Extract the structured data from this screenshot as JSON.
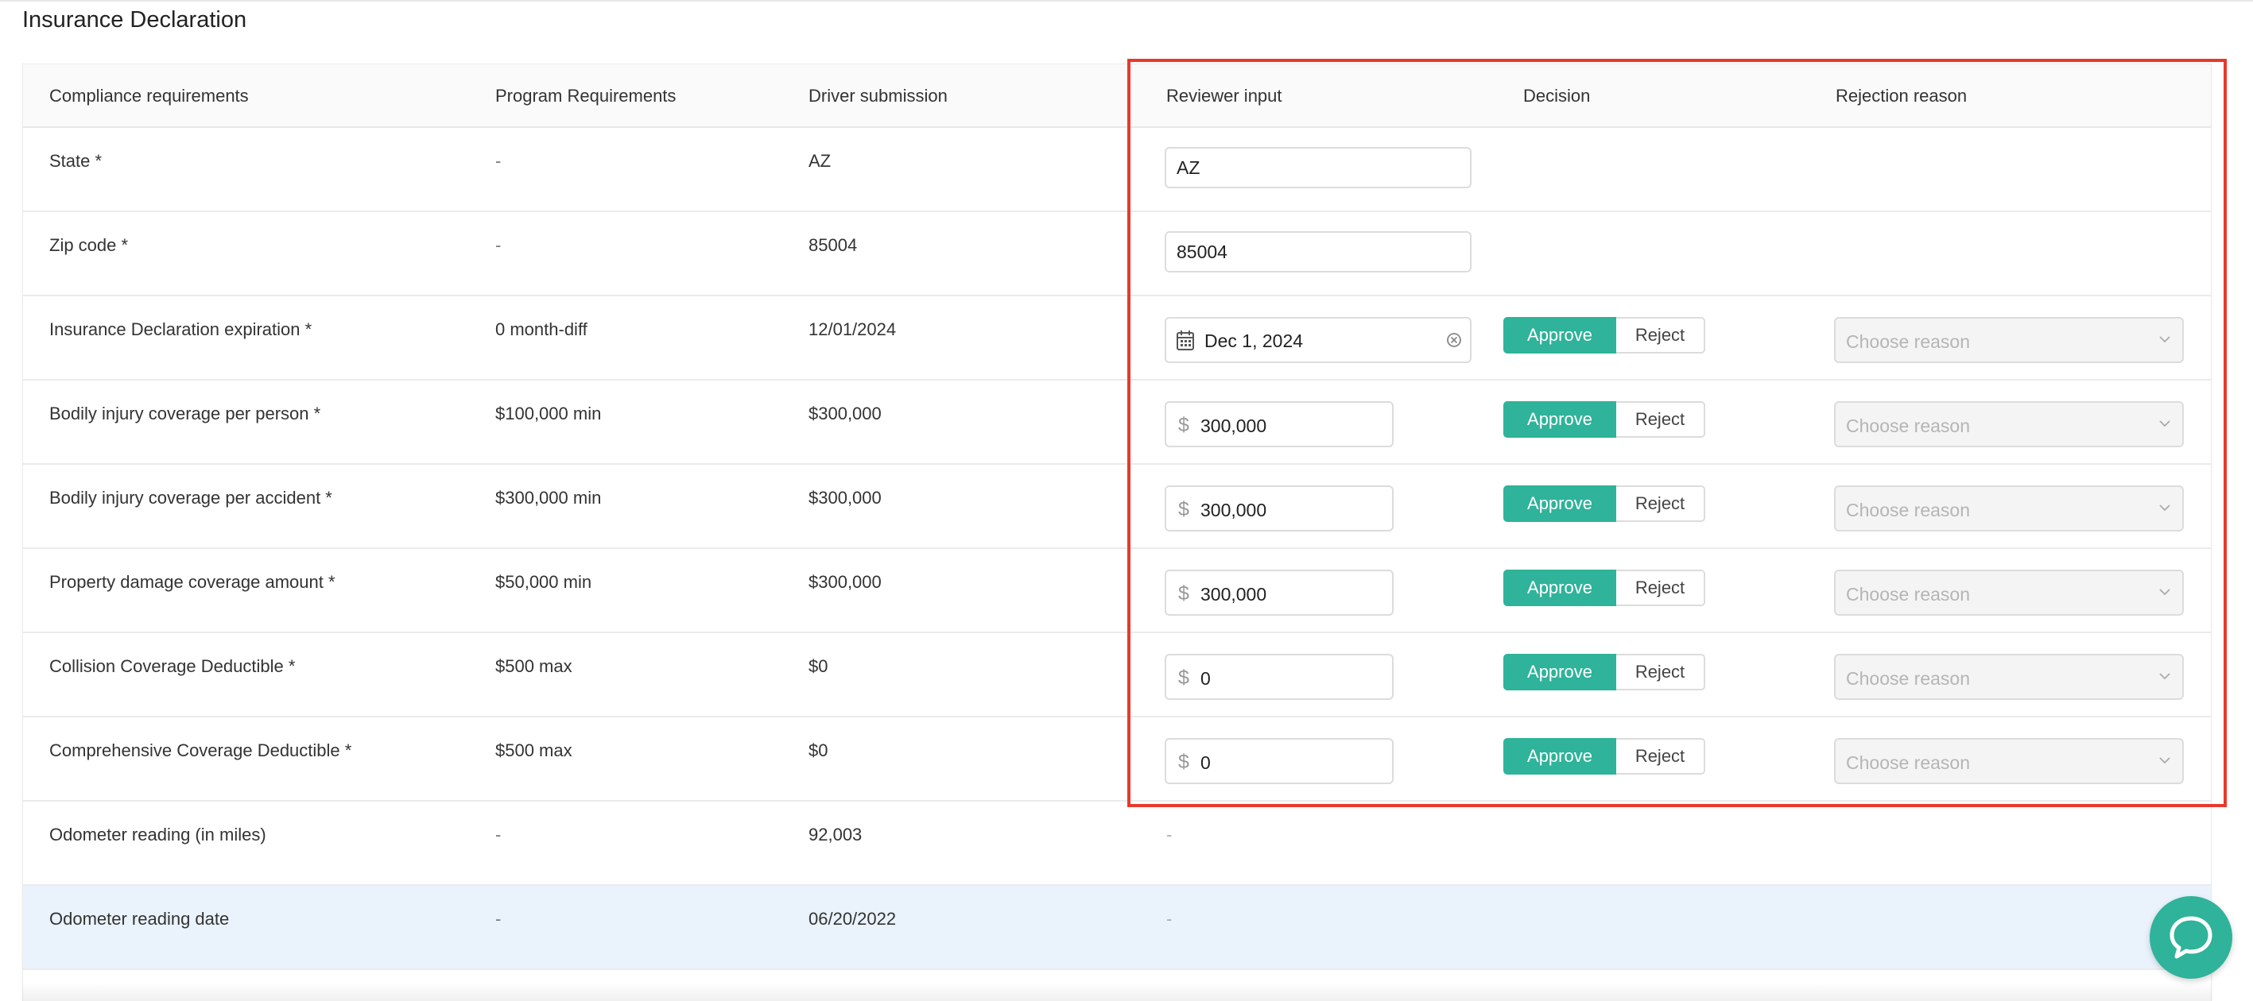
{
  "page": {
    "title": "Insurance Declaration"
  },
  "table": {
    "headers": {
      "compliance": "Compliance requirements",
      "program": "Program Requirements",
      "driver": "Driver submission",
      "reviewer": "Reviewer input",
      "decision": "Decision",
      "rejection": "Rejection reason"
    },
    "rows": [
      {
        "requirement": "State *",
        "program": "-",
        "driver": "AZ",
        "reviewer_value": "AZ"
      },
      {
        "requirement": "Zip code *",
        "program": "-",
        "driver": "85004",
        "reviewer_value": "85004"
      },
      {
        "requirement": "Insurance Declaration expiration *",
        "program": "0 month-diff",
        "driver": "12/01/2024",
        "reviewer_value": "Dec 1, 2024",
        "approve": "Approve",
        "reject": "Reject",
        "reason_placeholder": "Choose reason"
      },
      {
        "requirement": "Bodily injury coverage per person *",
        "program": "$100,000 min",
        "driver": "$300,000",
        "currency": "$",
        "reviewer_value": "300,000",
        "approve": "Approve",
        "reject": "Reject",
        "reason_placeholder": "Choose reason"
      },
      {
        "requirement": "Bodily injury coverage per accident *",
        "program": "$300,000 min",
        "driver": "$300,000",
        "currency": "$",
        "reviewer_value": "300,000",
        "approve": "Approve",
        "reject": "Reject",
        "reason_placeholder": "Choose reason"
      },
      {
        "requirement": "Property damage coverage amount *",
        "program": "$50,000 min",
        "driver": "$300,000",
        "currency": "$",
        "reviewer_value": "300,000",
        "approve": "Approve",
        "reject": "Reject",
        "reason_placeholder": "Choose reason"
      },
      {
        "requirement": "Collision Coverage Deductible *",
        "program": "$500 max",
        "driver": "$0",
        "currency": "$",
        "reviewer_value": "0",
        "approve": "Approve",
        "reject": "Reject",
        "reason_placeholder": "Choose reason"
      },
      {
        "requirement": "Comprehensive Coverage Deductible *",
        "program": "$500 max",
        "driver": "$0",
        "currency": "$",
        "reviewer_value": "0",
        "approve": "Approve",
        "reject": "Reject",
        "reason_placeholder": "Choose reason"
      },
      {
        "requirement": "Odometer reading (in miles)",
        "program": "-",
        "driver": "92,003",
        "reviewer_value": "-"
      },
      {
        "requirement": "Odometer reading date",
        "program": "-",
        "driver": "06/20/2022",
        "reviewer_value": "-"
      }
    ]
  },
  "colors": {
    "accent": "#2fb39a",
    "highlight_box": "#e8392c",
    "selected_row": "#eaf3fc"
  },
  "icons": {
    "date": "calendar-icon",
    "clear": "clear-circle-icon",
    "dropdown": "chevron-down-icon",
    "chat": "chat-bubble-icon"
  }
}
